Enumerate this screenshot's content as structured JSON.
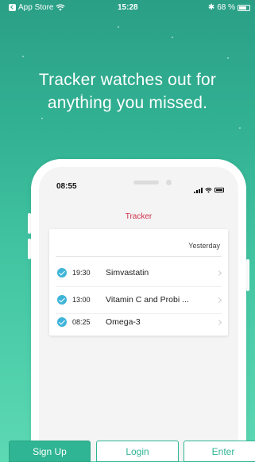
{
  "status_bar": {
    "back_label": "App Store",
    "time": "15:28",
    "battery": "68 %"
  },
  "headline": {
    "line1": "Tracker watches out for",
    "line2": "anything you missed."
  },
  "phone": {
    "time": "08:55",
    "app_title": "Tracker",
    "card": {
      "header": "Yesterday",
      "rows": [
        {
          "time": "19:30",
          "name": "Simvastatin"
        },
        {
          "time": "13:00",
          "name": "Vitamin C and Probi ..."
        },
        {
          "time": "08:25",
          "name": "Omega-3"
        }
      ]
    }
  },
  "buttons": {
    "signup": "Sign Up",
    "login": "Login",
    "enter": "Enter"
  },
  "colors": {
    "accent": "#2fb593",
    "check": "#3fb4d9",
    "app_title": "#d0304a"
  }
}
